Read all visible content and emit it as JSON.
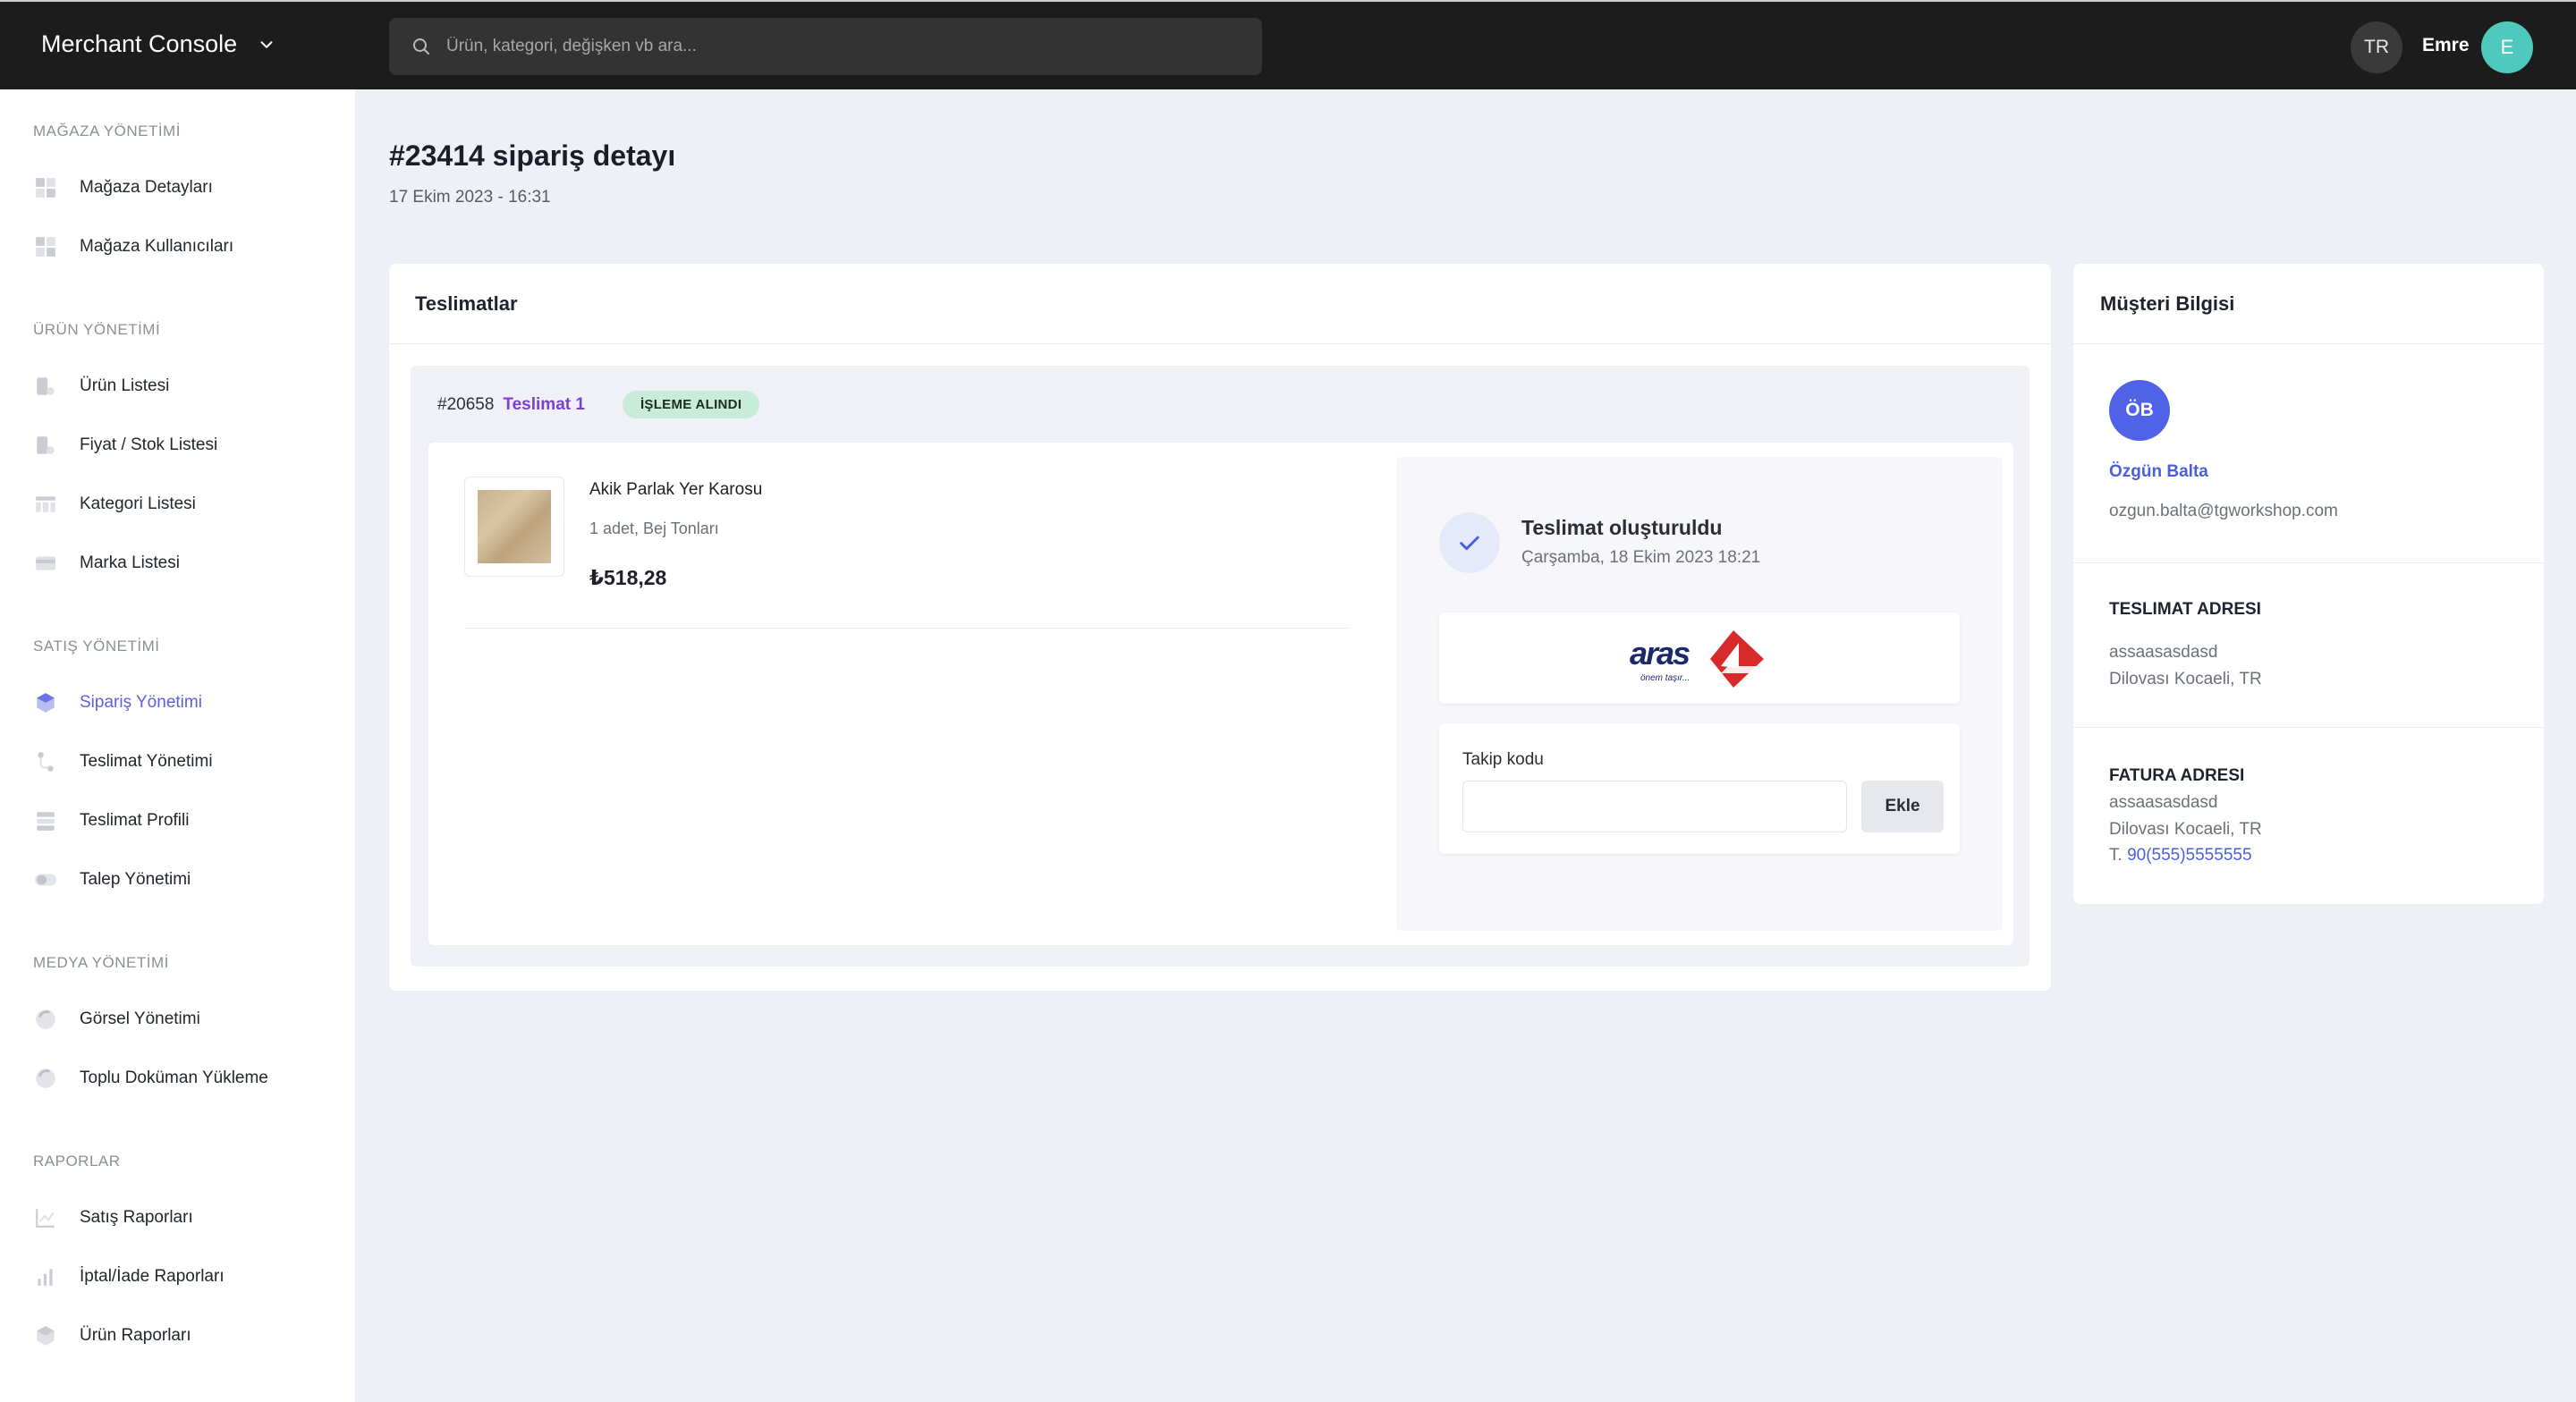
{
  "topbar": {
    "brand": "Merchant Console",
    "search_placeholder": "Ürün, kategori, değişken vb ara...",
    "language": "TR",
    "user_name": "Emre",
    "user_initial": "E"
  },
  "sidebar": {
    "sections": [
      {
        "title": "MAĞAZA YÖNETİMİ",
        "items": [
          "Mağaza Detayları",
          "Mağaza Kullanıcıları"
        ]
      },
      {
        "title": "ÜRÜN YÖNETİMİ",
        "items": [
          "Ürün Listesi",
          "Fiyat / Stok Listesi",
          "Kategori Listesi",
          "Marka Listesi"
        ]
      },
      {
        "title": "SATIŞ YÖNETİMİ",
        "items": [
          "Sipariş Yönetimi",
          "Teslimat Yönetimi",
          "Teslimat Profili",
          "Talep Yönetimi"
        ]
      },
      {
        "title": "MEDYA YÖNETİMİ",
        "items": [
          "Görsel Yönetimi",
          "Toplu Doküman Yükleme"
        ]
      },
      {
        "title": "RAPORLAR",
        "items": [
          "Satış Raporları",
          "İptal/İade Raporları",
          "Ürün Raporları"
        ]
      }
    ],
    "active_item": "Sipariş Yönetimi"
  },
  "order": {
    "title": "#23414 sipariş detayı",
    "date": "17 Ekim 2023 - 16:31"
  },
  "deliveries": {
    "card_title": "Teslimatlar",
    "shipment": {
      "id": "#20658",
      "name": "Teslimat 1",
      "status": "İŞLEME ALINDI",
      "product": {
        "name": "Akik Parlak Yer Karosu",
        "meta": "1 adet, Bej Tonları",
        "price": "₺518,28"
      },
      "tracking": {
        "status_title": "Teslimat oluşturuldu",
        "status_date": "Çarşamba, 18 Ekim 2023 18:21",
        "carrier_logo": "aras",
        "carrier_slogan": "önem taşır...",
        "tracking_label": "Takip kodu",
        "tracking_value": "",
        "add_button": "Ekle"
      }
    }
  },
  "customer": {
    "card_title": "Müşteri Bilgisi",
    "initials": "ÖB",
    "name": "Özgün Balta",
    "email": "ozgun.balta@tgworkshop.com",
    "shipping_title": "TESLIMAT ADRESI",
    "shipping_line1": "assaasasdasd",
    "shipping_line2": "Dilovası Kocaeli, TR",
    "billing_title": "FATURA ADRESI",
    "billing_line1": "assaasasdasd",
    "billing_line2": "Dilovası Kocaeli, TR",
    "phone_prefix": "T.",
    "phone": "90(555)5555555"
  },
  "colors": {
    "accent": "#5c5fe0",
    "topbar": "#1c1c1c",
    "badge_bg": "#c8ecd9",
    "user_avatar": "#4fc9bd",
    "customer_avatar": "#4f62e8"
  }
}
